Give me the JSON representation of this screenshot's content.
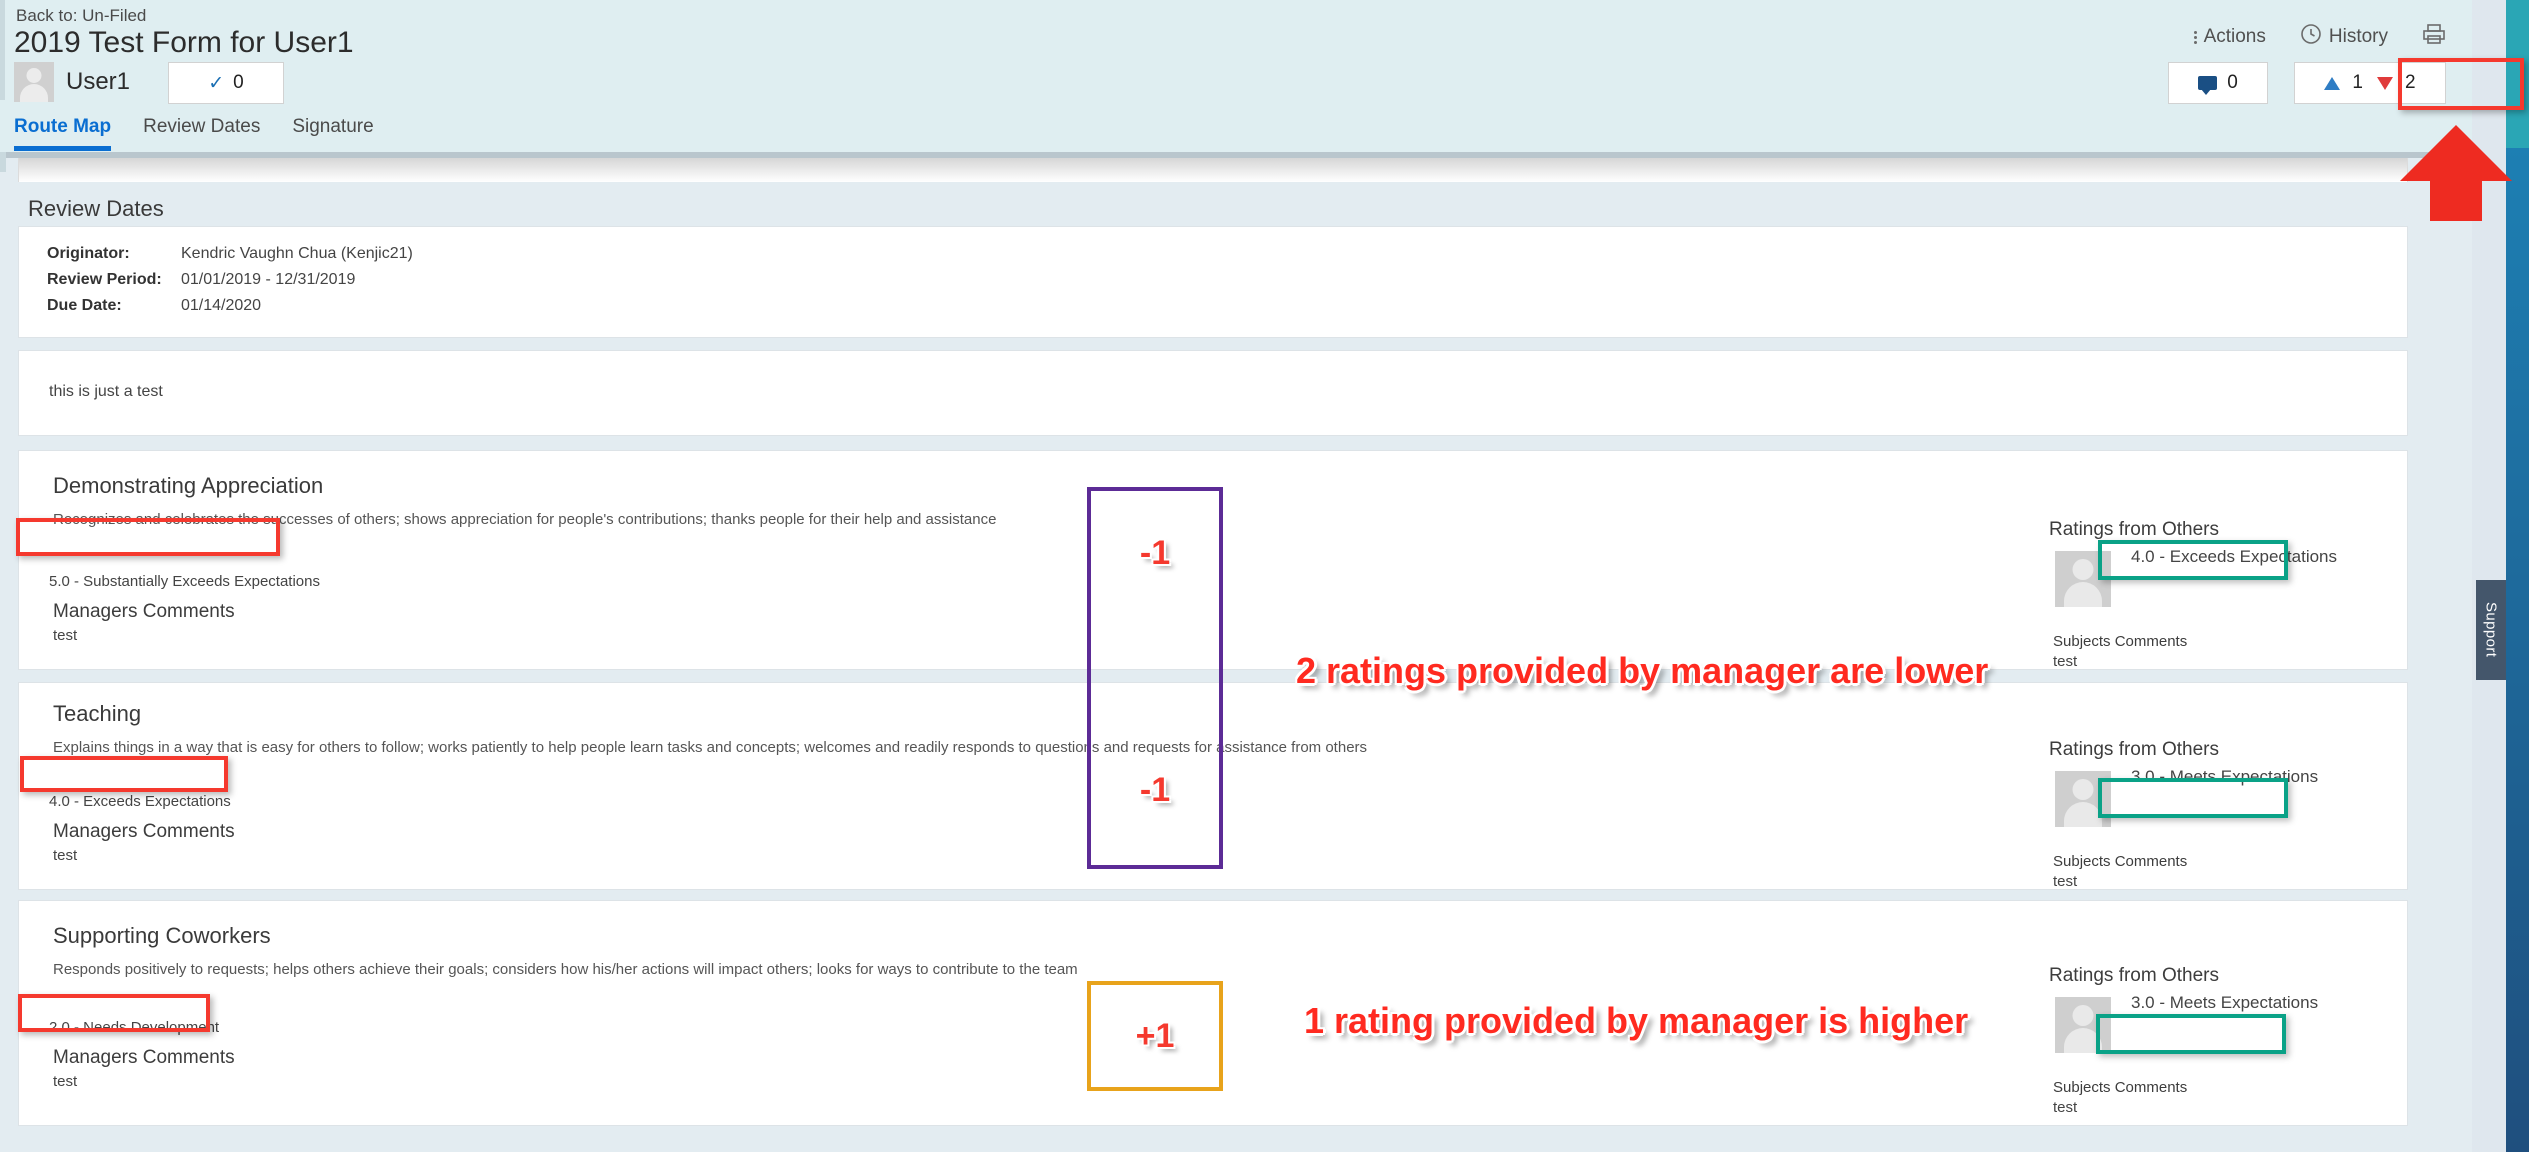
{
  "header": {
    "back_link": "Back to: Un-Filed",
    "title": "2019 Test Form for User1",
    "user_name": "User1",
    "goal_count": "0",
    "goal_icon": "check-icon",
    "actions_label": "Actions",
    "history_label": "History",
    "print_icon": "printer-icon",
    "comment_count": "0",
    "rating_up_count": "1",
    "rating_down_count": "2",
    "tabs": [
      {
        "label": "Route Map",
        "active": true
      },
      {
        "label": "Review Dates",
        "active": false
      },
      {
        "label": "Signature",
        "active": false
      }
    ]
  },
  "right_rail": {
    "support_label": "Support",
    "teal_color": "#2aa6b5",
    "blue_color": "#1d7fb3"
  },
  "review_dates": {
    "section_title": "Review Dates",
    "rows": [
      {
        "label": "Originator:",
        "value": "Kendric Vaughn Chua (Kenjic21)"
      },
      {
        "label": "Review Period:",
        "value": "01/01/2019 - 12/31/2019"
      },
      {
        "label": "Due Date:",
        "value": "01/14/2020"
      }
    ]
  },
  "intro_comment": {
    "text": "this is just a test"
  },
  "competencies": [
    {
      "title": "Demonstrating Appreciation",
      "description": "Recognizes and celebrates the successes of others; shows appreciation for people's contributions; thanks people for their help and assistance",
      "manager_rating": "5.0 - Substantially Exceeds Expectations",
      "managers_comments_label": "Managers Comments",
      "managers_comments_text": "test",
      "ratings_from_others_label": "Ratings from Others",
      "other_rating": "4.0 - Exceeds Expectations",
      "subjects_comments_label": "Subjects Comments",
      "subjects_comments_text": "test",
      "delta": "-1"
    },
    {
      "title": "Teaching",
      "description": "Explains things in a way that is easy for others to follow; works patiently to help people learn tasks and concepts; welcomes and readily responds to questions and requests for assistance from others",
      "manager_rating": "4.0 - Exceeds Expectations",
      "managers_comments_label": "Managers Comments",
      "managers_comments_text": "test",
      "ratings_from_others_label": "Ratings from Others",
      "other_rating": "3.0 - Meets Expectations",
      "subjects_comments_label": "Subjects Comments",
      "subjects_comments_text": "test",
      "delta": "-1"
    },
    {
      "title": "Supporting Coworkers",
      "description": "Responds positively to requests; helps others achieve their goals; considers how his/her actions will impact others; looks for ways to contribute to the team",
      "manager_rating": "2.0 - Needs Development",
      "managers_comments_label": "Managers Comments",
      "managers_comments_text": "test",
      "ratings_from_others_label": "Ratings from Others",
      "other_rating": "3.0 - Meets Expectations",
      "subjects_comments_label": "Subjects Comments",
      "subjects_comments_text": "test",
      "delta": "+1"
    }
  ],
  "annotations": {
    "caption_lower": "2 ratings provided by manager are lower",
    "caption_higher": "1 rating provided by manager is higher",
    "red_color": "#f5392e",
    "green_color": "#0aa287",
    "purple_color": "#5c2b96",
    "orange_color": "#e8a31b",
    "arrow_color": "#ee2b21"
  }
}
